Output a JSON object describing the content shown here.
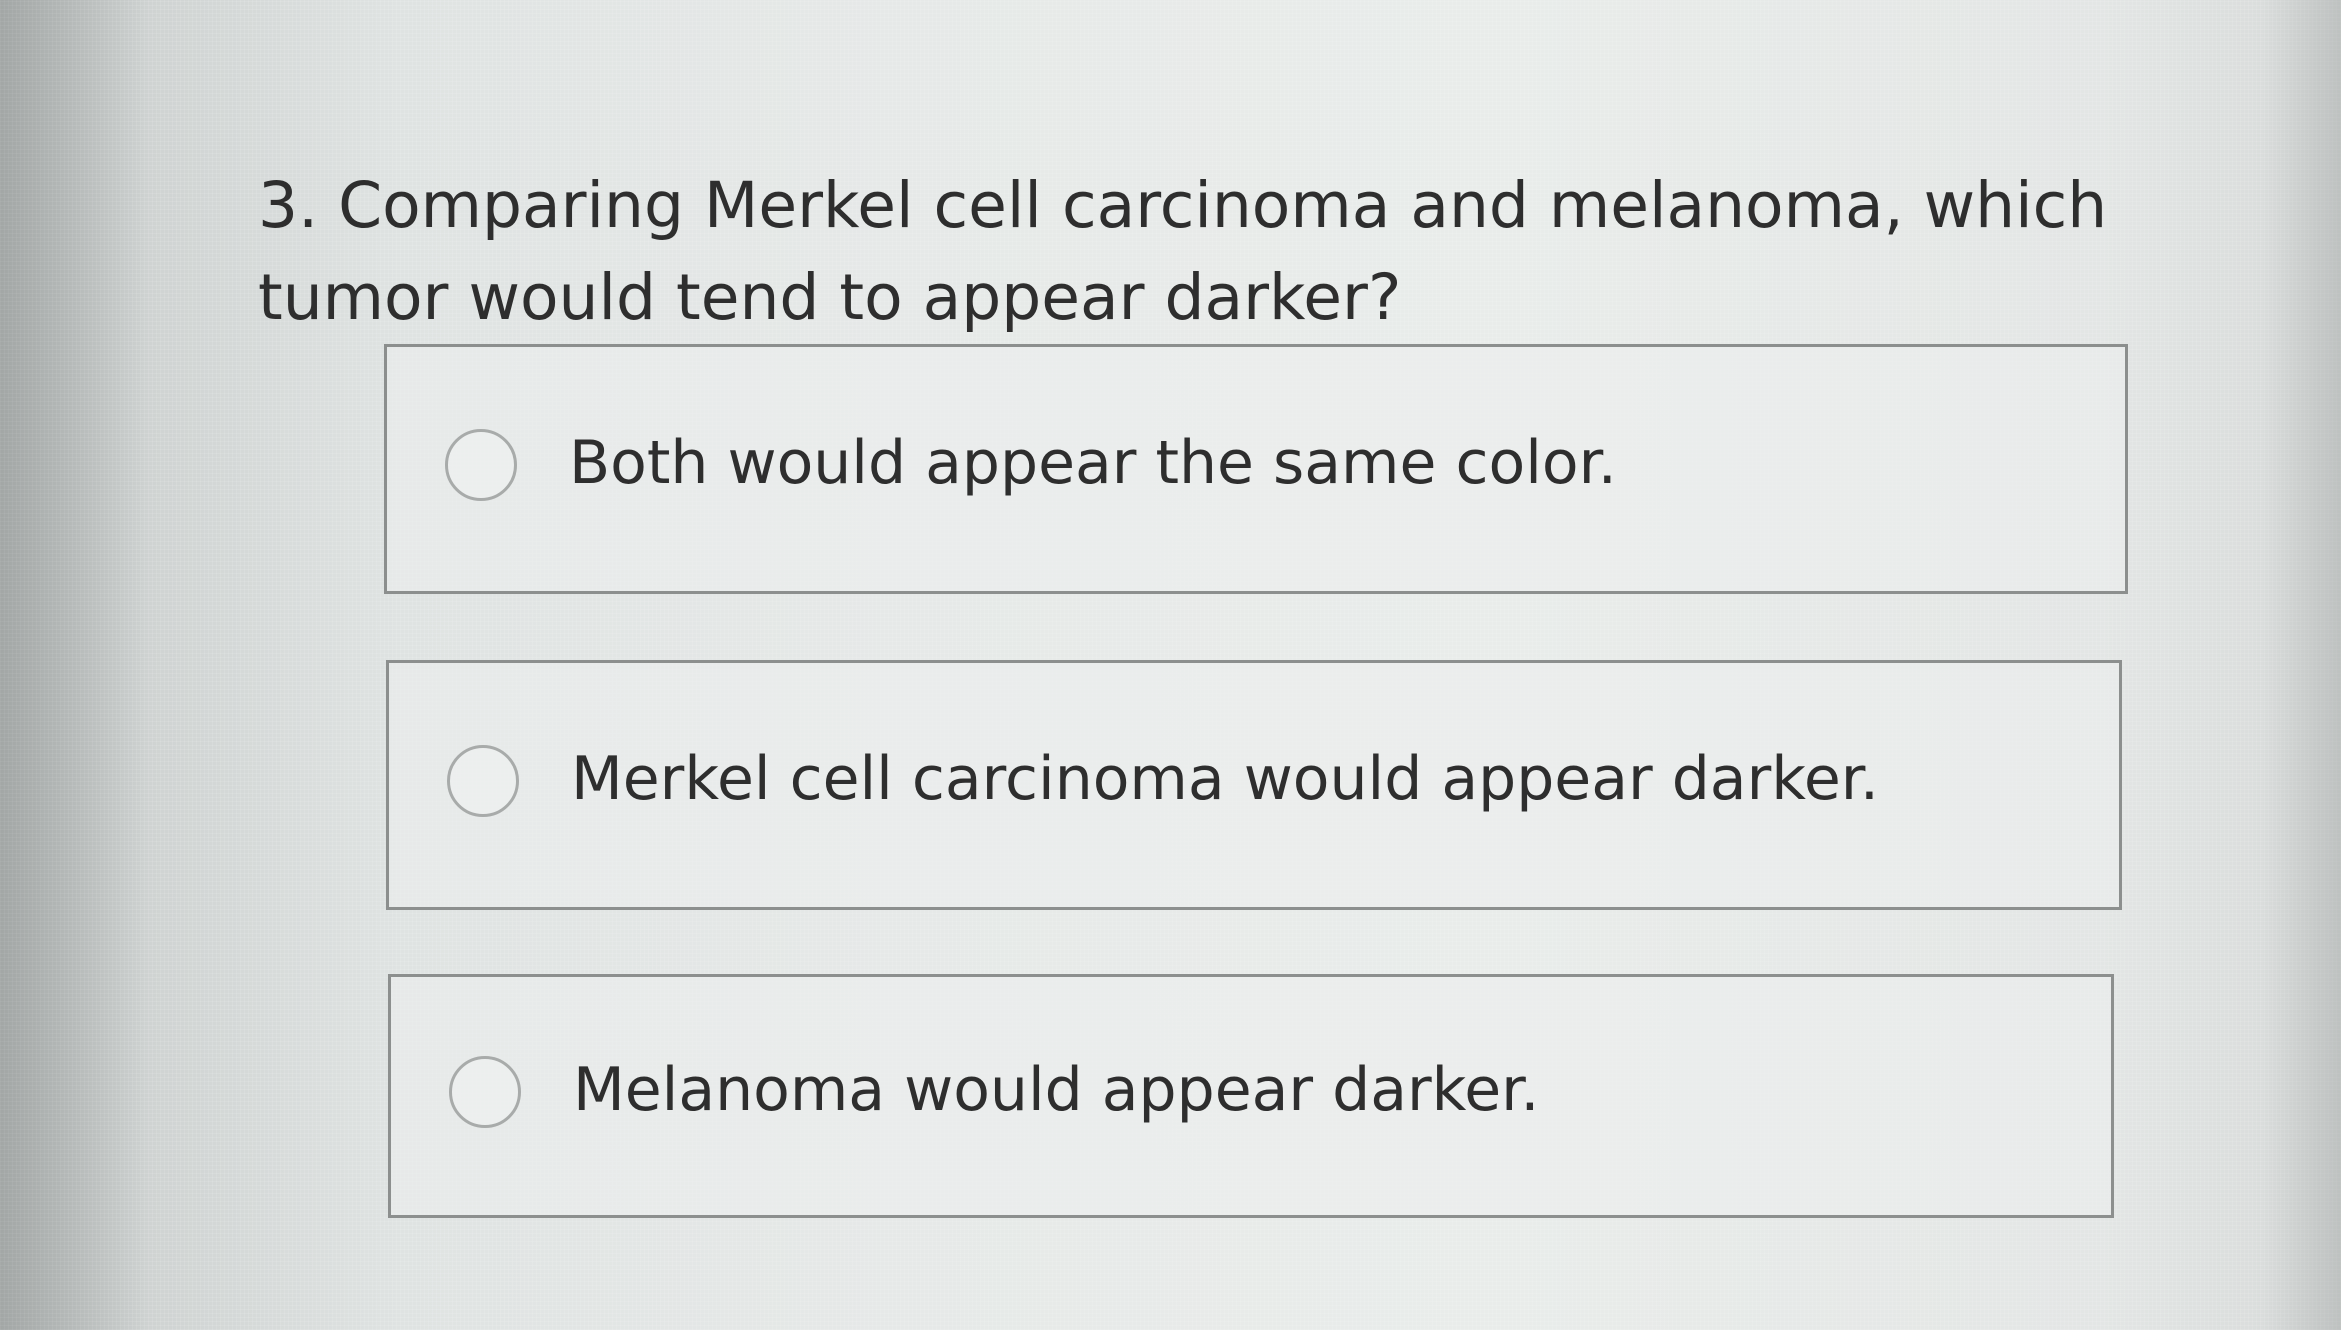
{
  "question": {
    "text": "3. Comparing Merkel cell carcinoma and melanoma, which tumor would tend to appear darker?"
  },
  "options": [
    {
      "label": "Both would appear the same color.",
      "selected": false
    },
    {
      "label": "Merkel cell carcinoma would appear darker.",
      "selected": false
    },
    {
      "label": "Melanoma would appear darker.",
      "selected": false
    }
  ]
}
